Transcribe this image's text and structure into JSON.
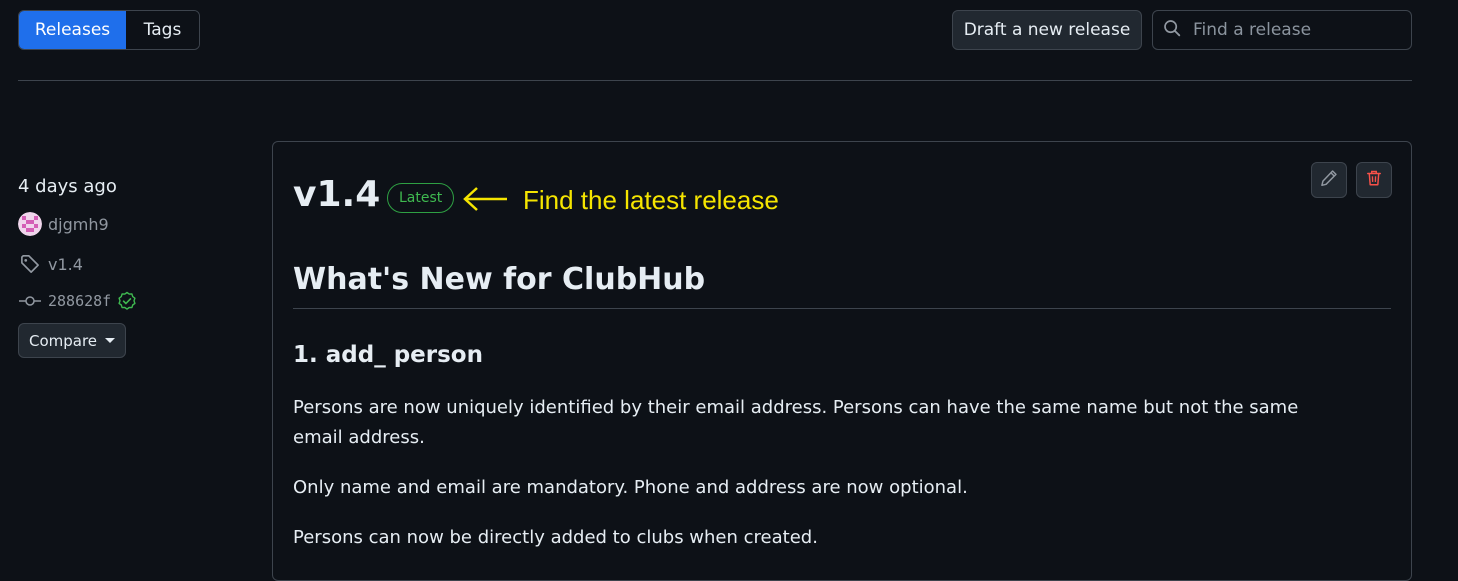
{
  "tabs": {
    "releases_label": "Releases",
    "tags_label": "Tags"
  },
  "toolbar": {
    "draft_label": "Draft a new release",
    "search_placeholder": "Find a release"
  },
  "release": {
    "date": "4 days ago",
    "author": "djgmh9",
    "tag": "v1.4",
    "commit": "288628f",
    "compare_label": "Compare",
    "version": "v1.4",
    "badge": "Latest",
    "annotation": "Find the latest release",
    "body": {
      "heading": "What's New for ClubHub",
      "subheading": "1. add_ person",
      "paragraphs": [
        "Persons are now uniquely identified by their email address. Persons can have the same name but not the same email address.",
        "Only name and email are mandatory. Phone and address are now optional.",
        "Persons can now be directly added to clubs when created."
      ]
    }
  },
  "colors": {
    "background": "#0d1117",
    "accent": "#1f6feb",
    "latest_green": "#3fb950",
    "annotation_yellow": "#f5e500",
    "delete_red": "#f85149"
  },
  "icons": {
    "search": "search-icon",
    "tag": "tag-icon",
    "commit": "git-commit-icon",
    "verified": "verified-check-icon",
    "edit": "pencil-icon",
    "delete": "trash-icon",
    "arrow": "arrow-left-icon"
  }
}
